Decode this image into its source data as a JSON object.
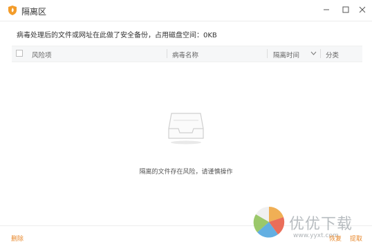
{
  "window": {
    "title": "隔离区",
    "controls": {
      "minimize_icon": "minimize-icon",
      "maximize_icon": "maximize-icon",
      "close_icon": "close-icon"
    }
  },
  "info": {
    "description": "病毒处理后的文件或网址在此做了安全备份，占用磁盘空间：0KB"
  },
  "table": {
    "columns": [
      {
        "label": "风险项"
      },
      {
        "label": "病毒名称"
      },
      {
        "label": "隔离时间"
      },
      {
        "label": "分类"
      }
    ],
    "rows": []
  },
  "empty_state": {
    "icon": "empty-tray-icon",
    "message": "隔离的文件存在风险，请谨慎操作"
  },
  "footer": {
    "delete_label": "删除",
    "restore_label": "恢复",
    "extract_label": "提取"
  },
  "watermark": {
    "text": "优优下载",
    "url": "www.yyxt.com"
  },
  "colors": {
    "accent": "#e8892e",
    "header_bg": "#f6f7f8"
  }
}
